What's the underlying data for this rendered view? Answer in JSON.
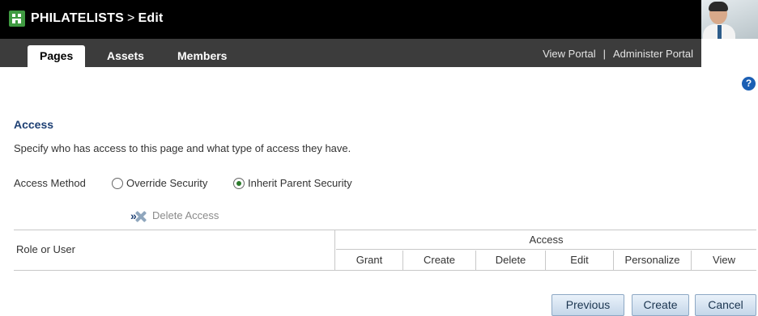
{
  "header": {
    "app_name": "PHILATELISTS",
    "separator": ">",
    "page": "Edit"
  },
  "nav": {
    "tabs": [
      {
        "label": "Pages",
        "active": true
      },
      {
        "label": "Assets",
        "active": false
      },
      {
        "label": "Members",
        "active": false
      }
    ],
    "links": {
      "view_portal": "View Portal",
      "divider": "|",
      "administer_portal": "Administer Portal"
    }
  },
  "help_icon": "?",
  "access": {
    "title": "Access",
    "description": "Specify who has access to this page and what type of access they have.",
    "method_label": "Access Method",
    "options": [
      {
        "label": "Override Security",
        "selected": false
      },
      {
        "label": "Inherit Parent Security",
        "selected": true
      }
    ]
  },
  "toolbar": {
    "expand_glyph": "»",
    "delete_label": "Delete Access"
  },
  "table": {
    "role_header": "Role or User",
    "access_header": "Access",
    "columns": [
      "Grant",
      "Create",
      "Delete",
      "Edit",
      "Personalize",
      "View"
    ]
  },
  "buttons": {
    "previous": "Previous",
    "create": "Create",
    "cancel": "Cancel"
  },
  "colors": {
    "header_bg": "#000000",
    "nav_bg": "#3c3c3c",
    "title_blue": "#1d3f73",
    "logo_green": "#3f9a41"
  }
}
